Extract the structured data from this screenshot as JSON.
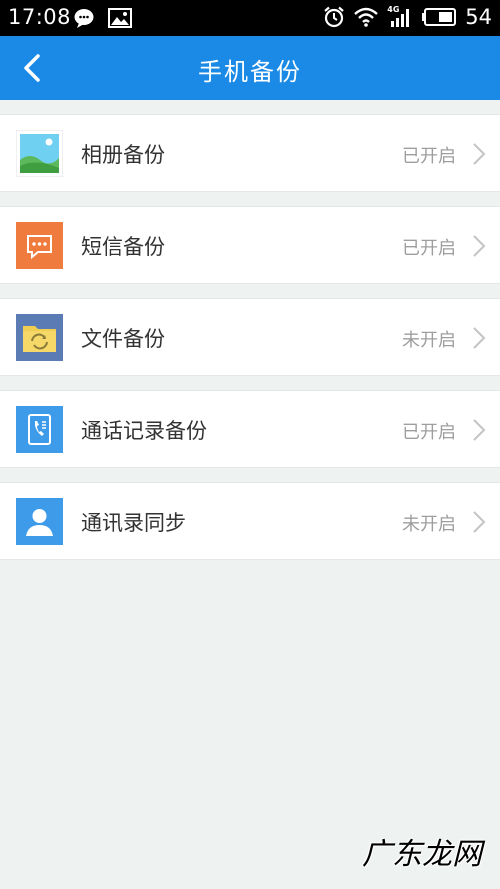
{
  "status_bar": {
    "time": "17:08",
    "network": "4G",
    "battery": "54"
  },
  "app_bar": {
    "title": "手机备份",
    "background": "#1a8ae6"
  },
  "items": [
    {
      "label": "相册备份",
      "status": "已开启",
      "icon": "photo-album-icon",
      "icon_color": "#4caf50"
    },
    {
      "label": "短信备份",
      "status": "已开启",
      "icon": "sms-icon",
      "icon_color": "#f07b3f"
    },
    {
      "label": "文件备份",
      "status": "未开启",
      "icon": "folder-sync-icon",
      "icon_color": "#e8c24a"
    },
    {
      "label": "通话记录备份",
      "status": "已开启",
      "icon": "call-log-icon",
      "icon_color": "#3d9be9"
    },
    {
      "label": "通讯录同步",
      "status": "未开启",
      "icon": "contacts-icon",
      "icon_color": "#3d9be9"
    }
  ],
  "watermark": "广东龙网"
}
